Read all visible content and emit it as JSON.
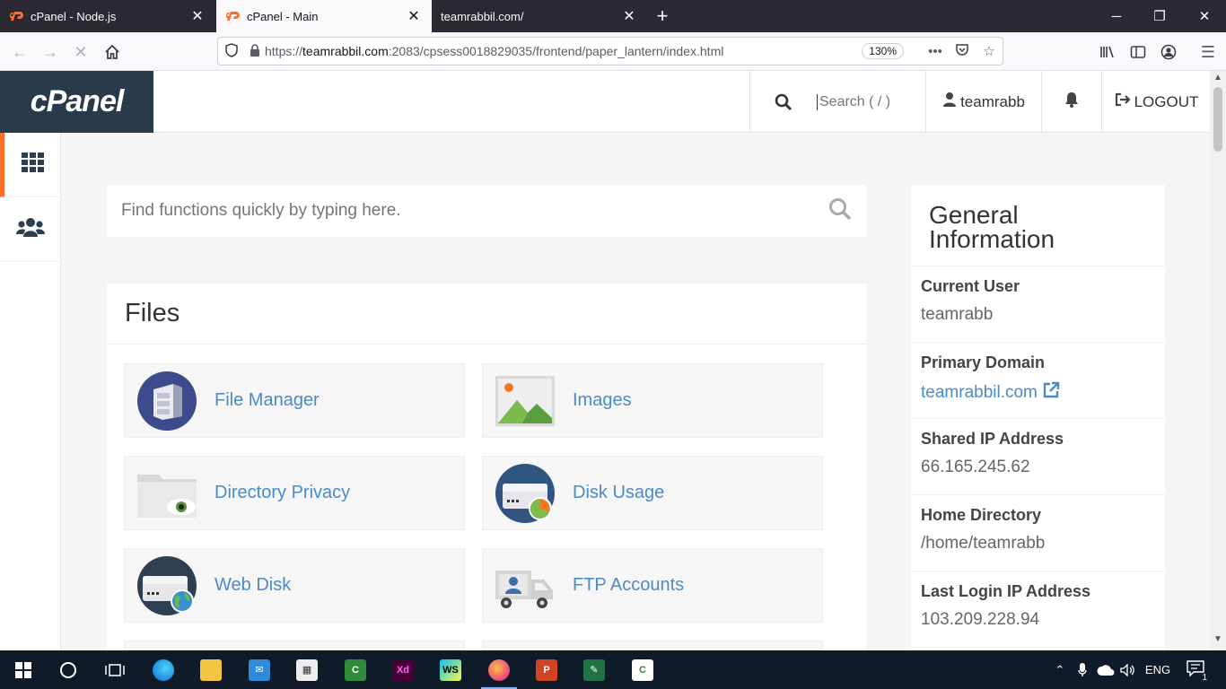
{
  "browser": {
    "tabs": [
      {
        "title": "cPanel - Node.js",
        "active": false
      },
      {
        "title": "cPanel - Main",
        "active": true
      },
      {
        "title": "teamrabbil.com/",
        "active": false
      }
    ],
    "url_prefix": "https://",
    "url_host": "teamrabbil.com",
    "url_rest": ":2083/cpsess0018829035/frontend/paper_lantern/index.html",
    "zoom": "130%"
  },
  "header": {
    "logo": "cPanel",
    "search_placeholder": "Search ( / )",
    "user": "teamrabb",
    "logout": "LOGOUT"
  },
  "main": {
    "quick_search_placeholder": "Find functions quickly by typing here.",
    "files_title": "Files",
    "tools": [
      {
        "label": "File Manager"
      },
      {
        "label": "Images"
      },
      {
        "label": "Directory Privacy"
      },
      {
        "label": "Disk Usage"
      },
      {
        "label": "Web Disk"
      },
      {
        "label": "FTP Accounts"
      }
    ]
  },
  "info": {
    "title": "General Information",
    "rows": [
      {
        "key": "Current User",
        "value": "teamrabb"
      },
      {
        "key": "Primary Domain",
        "value": "teamrabbil.com"
      },
      {
        "key": "Shared IP Address",
        "value": "66.165.245.62"
      },
      {
        "key": "Home Directory",
        "value": "/home/teamrabb"
      },
      {
        "key": "Last Login IP Address",
        "value": "103.209.228.94"
      }
    ]
  },
  "taskbar": {
    "language": "ENG",
    "notifications": "1"
  },
  "colors": {
    "cpanel_orange": "#ff6c2c",
    "link_blue": "#4a8bc8",
    "logo_bg": "#293a4a"
  }
}
